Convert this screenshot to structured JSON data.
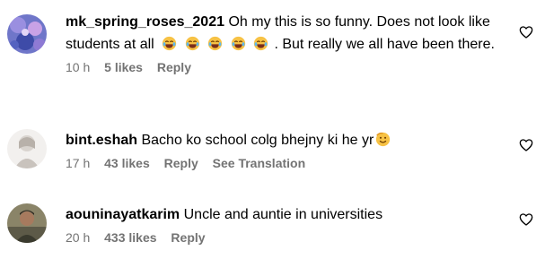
{
  "comments": [
    {
      "username": "mk_spring_roses_2021",
      "text_before_emoji": "Oh my this is so funny. Does not look like students at all",
      "emojis": [
        "laughing-face",
        "laughing-face",
        "laughing-face",
        "laughing-face",
        "laughing-face"
      ],
      "text_after_emoji": ". But really we all have been there.",
      "time": "10 h",
      "likes": "5 likes",
      "reply_label": "Reply",
      "avatar_icon": "floral-purple-avatar"
    },
    {
      "username": "bint.eshah",
      "text": "Bacho ko school colg bhejny ki he yr",
      "trailing_emoji": "smiling-face-emoji",
      "time": "17 h",
      "likes": "43 likes",
      "reply_label": "Reply",
      "translation_label": "See Translation",
      "avatar_icon": "profile-photo-avatar"
    },
    {
      "username": "aouninayatkarim",
      "text": "Uncle and auntie in universities",
      "time": "20 h",
      "likes": "433 likes",
      "reply_label": "Reply",
      "avatar_icon": "profile-photo-avatar"
    }
  ],
  "colors": {
    "text": "#000000",
    "meta": "#737373",
    "emoji_fill": "#f7c245"
  }
}
